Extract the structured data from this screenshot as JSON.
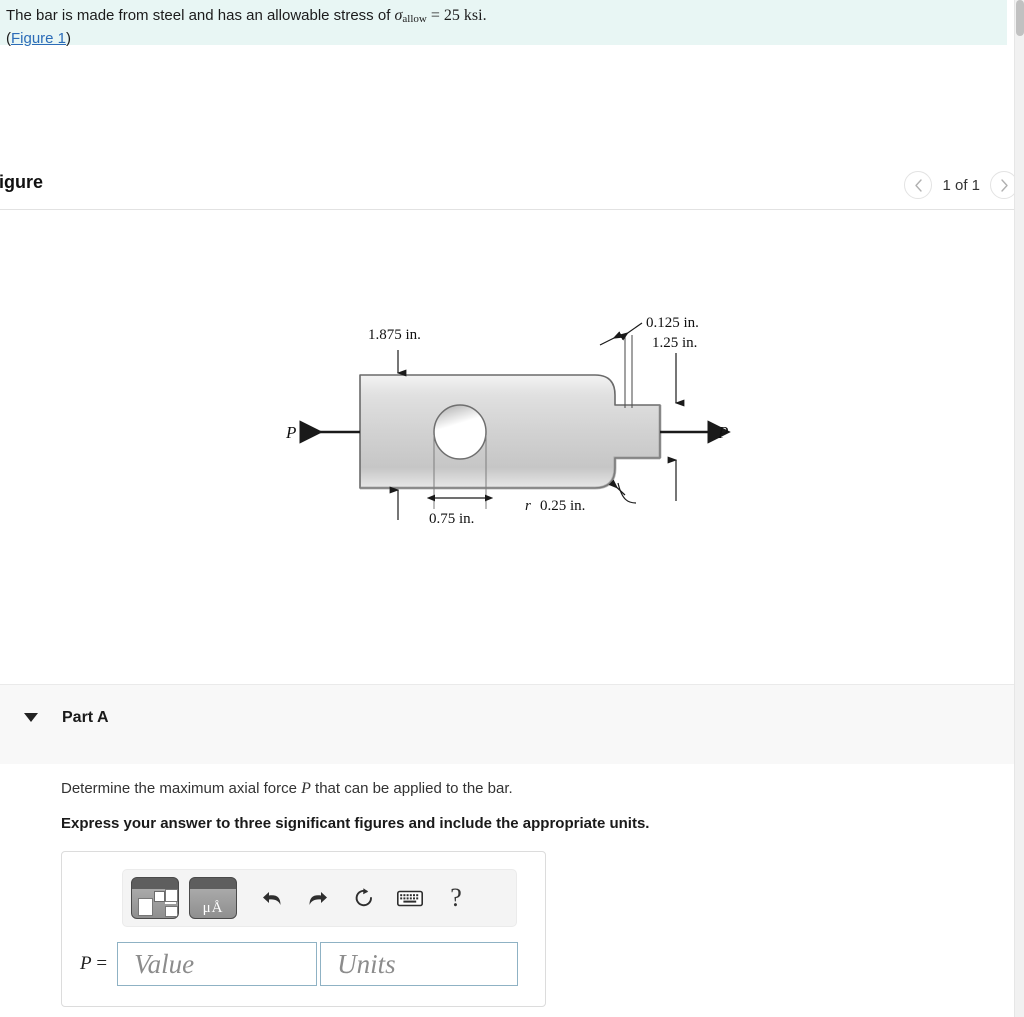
{
  "statement": {
    "text_before_symbol": "The bar is made from steel and has an allowable stress of ",
    "sigma_symbol": "σ",
    "sigma_subscript": "allow",
    "equals_value": " = 25 ksi.",
    "figure_link_open": "(",
    "figure_link_text": "Figure 1",
    "figure_link_close": ")"
  },
  "figure_panel": {
    "title": "Figure",
    "prev_icon": "chevron-left-icon",
    "next_icon": "chevron-right-icon",
    "page_counter": "1 of 1"
  },
  "figure": {
    "force_label_left": "P",
    "force_label_right": "P",
    "dim_width_left": "1.875 in.",
    "dim_thickness": "0.125 in.",
    "dim_width_right": "1.25 in.",
    "dim_hole": "0.75 in.",
    "fillet_symbol": "r",
    "dim_fillet": "0.25 in."
  },
  "part": {
    "caret_icon": "caret-down-icon",
    "label": "Part A",
    "question": "Determine the maximum axial force P that can be applied to the bar.",
    "question_pre": "Determine the maximum axial force ",
    "question_var": "P",
    "question_post": " that can be applied to the bar.",
    "instruction": "Express your answer to three significant figures and include the appropriate units."
  },
  "answer": {
    "toolbar": {
      "template_icon": "math-template-icon",
      "units_icon": "units-template-icon",
      "units_glyph": "μÅ",
      "undo_icon": "undo-icon",
      "redo_icon": "redo-icon",
      "reset_icon": "reset-icon",
      "keyboard_icon": "keyboard-icon",
      "help_icon": "help-icon",
      "help_glyph": "?"
    },
    "prefix_var": "P",
    "prefix_equals": "=",
    "value_placeholder": "Value",
    "units_placeholder": "Units",
    "value_text": "",
    "units_text": ""
  },
  "colors": {
    "statement_bg": "#e8f6f4",
    "link": "#2b6cb8",
    "band_bg": "#f8f8f8",
    "input_border": "#8fb2c4"
  }
}
